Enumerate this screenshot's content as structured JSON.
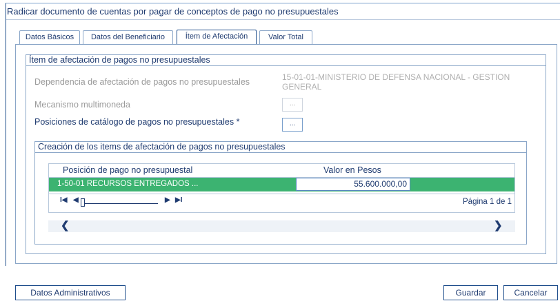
{
  "window": {
    "title": "Radicar documento de cuentas por pagar de conceptos de pago no presupuestales"
  },
  "tabs": [
    {
      "label": "Datos Básicos"
    },
    {
      "label": "Datos del Beneficiario"
    },
    {
      "label": "Ítem de Afectación"
    },
    {
      "label": "Valor Total"
    }
  ],
  "item_section": {
    "title": "Ítem de afectación de pagos no presupuestales",
    "dependencia_label": "Dependencia de afectación de pagos no presupuestales",
    "dependencia_value_line1": "15-01-01-MINISTERIO DE DEFENSA NACIONAL - GESTION",
    "dependencia_value_line2": "GENERAL",
    "mecanismo_label": "Mecanismo multimoneda",
    "posiciones_label": "Posiciones de catálogo de pagos no presupuestales *",
    "dots_label": "..."
  },
  "creation_section": {
    "title": "Creación de los items de afectación de pagos no presupuestales",
    "columns": [
      "Posición de pago no presupuestal",
      "Valor en Pesos"
    ],
    "rows": [
      {
        "posicion": "1-50-01 RECURSOS ENTREGADOS ...",
        "valor": "55.600.000,00"
      }
    ],
    "pager": {
      "first": "I◀",
      "prev": "◀",
      "next": "▶",
      "last": "▶I",
      "page_info": "Página 1 de 1"
    },
    "scroll_left": "❮",
    "scroll_right": "❯"
  },
  "footer": {
    "datos_administrativos": "Datos Administrativos",
    "guardar": "Guardar",
    "cancelar": "Cancelar"
  }
}
